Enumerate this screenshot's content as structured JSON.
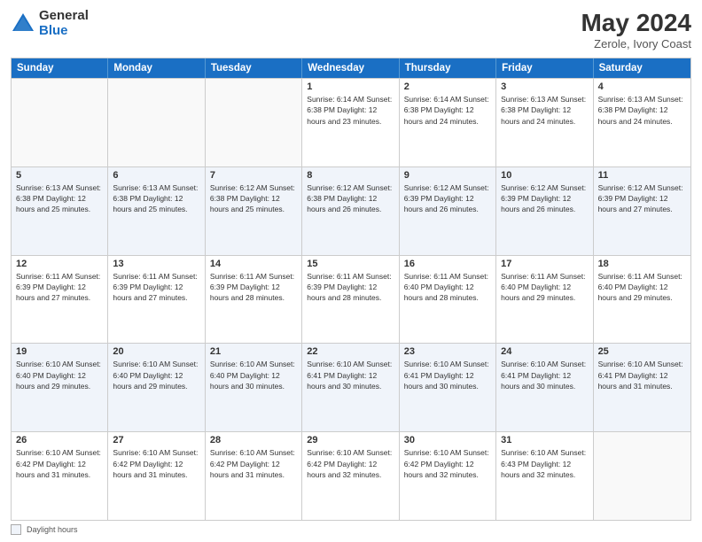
{
  "header": {
    "logo_general": "General",
    "logo_blue": "Blue",
    "title": "May 2024",
    "subtitle": "Zerole, Ivory Coast"
  },
  "calendar": {
    "days_of_week": [
      "Sunday",
      "Monday",
      "Tuesday",
      "Wednesday",
      "Thursday",
      "Friday",
      "Saturday"
    ],
    "weeks": [
      [
        {
          "day": "",
          "info": ""
        },
        {
          "day": "",
          "info": ""
        },
        {
          "day": "",
          "info": ""
        },
        {
          "day": "1",
          "info": "Sunrise: 6:14 AM\nSunset: 6:38 PM\nDaylight: 12 hours\nand 23 minutes."
        },
        {
          "day": "2",
          "info": "Sunrise: 6:14 AM\nSunset: 6:38 PM\nDaylight: 12 hours\nand 24 minutes."
        },
        {
          "day": "3",
          "info": "Sunrise: 6:13 AM\nSunset: 6:38 PM\nDaylight: 12 hours\nand 24 minutes."
        },
        {
          "day": "4",
          "info": "Sunrise: 6:13 AM\nSunset: 6:38 PM\nDaylight: 12 hours\nand 24 minutes."
        }
      ],
      [
        {
          "day": "5",
          "info": "Sunrise: 6:13 AM\nSunset: 6:38 PM\nDaylight: 12 hours\nand 25 minutes."
        },
        {
          "day": "6",
          "info": "Sunrise: 6:13 AM\nSunset: 6:38 PM\nDaylight: 12 hours\nand 25 minutes."
        },
        {
          "day": "7",
          "info": "Sunrise: 6:12 AM\nSunset: 6:38 PM\nDaylight: 12 hours\nand 25 minutes."
        },
        {
          "day": "8",
          "info": "Sunrise: 6:12 AM\nSunset: 6:38 PM\nDaylight: 12 hours\nand 26 minutes."
        },
        {
          "day": "9",
          "info": "Sunrise: 6:12 AM\nSunset: 6:39 PM\nDaylight: 12 hours\nand 26 minutes."
        },
        {
          "day": "10",
          "info": "Sunrise: 6:12 AM\nSunset: 6:39 PM\nDaylight: 12 hours\nand 26 minutes."
        },
        {
          "day": "11",
          "info": "Sunrise: 6:12 AM\nSunset: 6:39 PM\nDaylight: 12 hours\nand 27 minutes."
        }
      ],
      [
        {
          "day": "12",
          "info": "Sunrise: 6:11 AM\nSunset: 6:39 PM\nDaylight: 12 hours\nand 27 minutes."
        },
        {
          "day": "13",
          "info": "Sunrise: 6:11 AM\nSunset: 6:39 PM\nDaylight: 12 hours\nand 27 minutes."
        },
        {
          "day": "14",
          "info": "Sunrise: 6:11 AM\nSunset: 6:39 PM\nDaylight: 12 hours\nand 28 minutes."
        },
        {
          "day": "15",
          "info": "Sunrise: 6:11 AM\nSunset: 6:39 PM\nDaylight: 12 hours\nand 28 minutes."
        },
        {
          "day": "16",
          "info": "Sunrise: 6:11 AM\nSunset: 6:40 PM\nDaylight: 12 hours\nand 28 minutes."
        },
        {
          "day": "17",
          "info": "Sunrise: 6:11 AM\nSunset: 6:40 PM\nDaylight: 12 hours\nand 29 minutes."
        },
        {
          "day": "18",
          "info": "Sunrise: 6:11 AM\nSunset: 6:40 PM\nDaylight: 12 hours\nand 29 minutes."
        }
      ],
      [
        {
          "day": "19",
          "info": "Sunrise: 6:10 AM\nSunset: 6:40 PM\nDaylight: 12 hours\nand 29 minutes."
        },
        {
          "day": "20",
          "info": "Sunrise: 6:10 AM\nSunset: 6:40 PM\nDaylight: 12 hours\nand 29 minutes."
        },
        {
          "day": "21",
          "info": "Sunrise: 6:10 AM\nSunset: 6:40 PM\nDaylight: 12 hours\nand 30 minutes."
        },
        {
          "day": "22",
          "info": "Sunrise: 6:10 AM\nSunset: 6:41 PM\nDaylight: 12 hours\nand 30 minutes."
        },
        {
          "day": "23",
          "info": "Sunrise: 6:10 AM\nSunset: 6:41 PM\nDaylight: 12 hours\nand 30 minutes."
        },
        {
          "day": "24",
          "info": "Sunrise: 6:10 AM\nSunset: 6:41 PM\nDaylight: 12 hours\nand 30 minutes."
        },
        {
          "day": "25",
          "info": "Sunrise: 6:10 AM\nSunset: 6:41 PM\nDaylight: 12 hours\nand 31 minutes."
        }
      ],
      [
        {
          "day": "26",
          "info": "Sunrise: 6:10 AM\nSunset: 6:42 PM\nDaylight: 12 hours\nand 31 minutes."
        },
        {
          "day": "27",
          "info": "Sunrise: 6:10 AM\nSunset: 6:42 PM\nDaylight: 12 hours\nand 31 minutes."
        },
        {
          "day": "28",
          "info": "Sunrise: 6:10 AM\nSunset: 6:42 PM\nDaylight: 12 hours\nand 31 minutes."
        },
        {
          "day": "29",
          "info": "Sunrise: 6:10 AM\nSunset: 6:42 PM\nDaylight: 12 hours\nand 32 minutes."
        },
        {
          "day": "30",
          "info": "Sunrise: 6:10 AM\nSunset: 6:42 PM\nDaylight: 12 hours\nand 32 minutes."
        },
        {
          "day": "31",
          "info": "Sunrise: 6:10 AM\nSunset: 6:43 PM\nDaylight: 12 hours\nand 32 minutes."
        },
        {
          "day": "",
          "info": ""
        }
      ]
    ]
  },
  "footer": {
    "label": "Daylight hours"
  }
}
